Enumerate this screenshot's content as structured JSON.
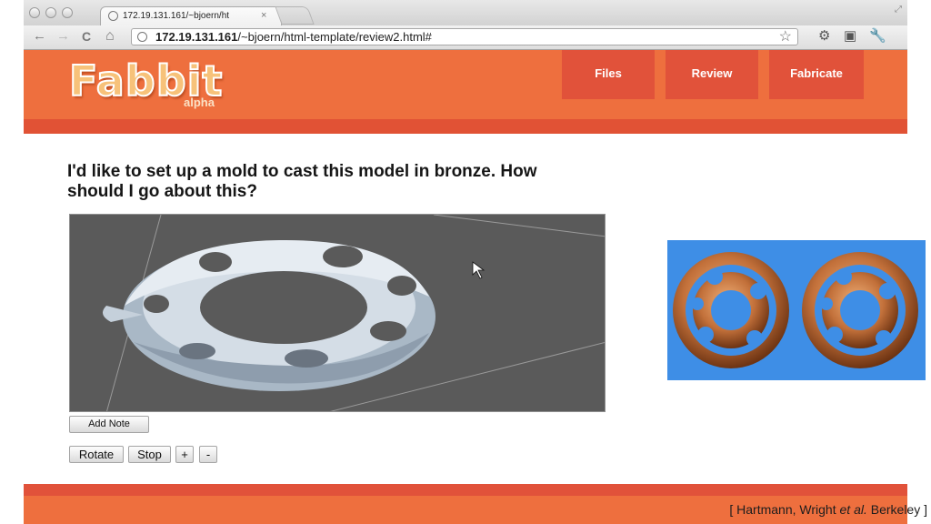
{
  "browser": {
    "tab": {
      "title": "172.19.131.161/~bjoern/ht",
      "close": "×"
    },
    "address": {
      "host": "172.19.131.161",
      "path": "/~bjoern/html-template/review2.html#"
    },
    "nav": {
      "back": "←",
      "forward": "→",
      "reload": "C",
      "home": "⌂"
    },
    "icons": [
      "back-arrow-icon",
      "forward-arrow-icon",
      "reload-icon",
      "home-icon",
      "page-icon",
      "star-icon",
      "wrench-icon"
    ]
  },
  "site": {
    "logo": "Fabbit",
    "logo_sub": "alpha",
    "nav": [
      {
        "label": "Files"
      },
      {
        "label": "Review"
      },
      {
        "label": "Fabricate"
      }
    ],
    "colors": {
      "header": "#ee6f3e",
      "stripe": "#e15235",
      "nav_button": "#e1523a"
    }
  },
  "main": {
    "question": "I'd like to set up a mold to cast this model in bronze. How should I go about this?",
    "add_note": "Add Note",
    "controls": {
      "rotate": "Rotate",
      "stop": "Stop",
      "plus": "+",
      "minus": "-"
    }
  },
  "attribution": {
    "prefix": "[ Hartmann, Wright ",
    "etal": "et al.",
    "suffix": " Berkeley ]"
  }
}
